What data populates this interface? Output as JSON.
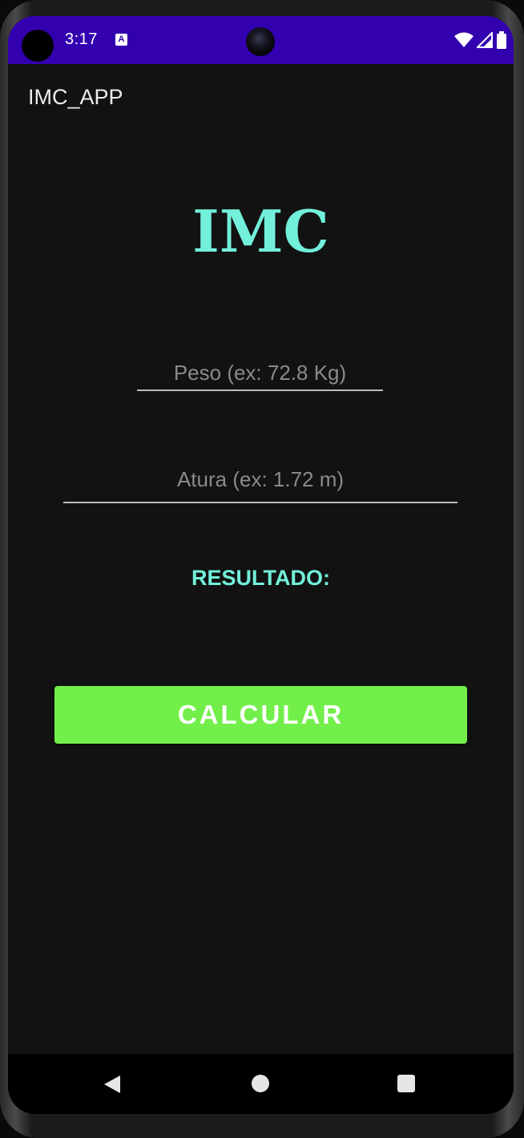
{
  "status_bar": {
    "time": "3:17",
    "notification_icon": "a-icon",
    "icons": [
      "wifi-icon",
      "signal-icon",
      "battery-icon"
    ]
  },
  "app_bar": {
    "title": "IMC_APP"
  },
  "main": {
    "heading": "IMC",
    "peso_input": {
      "value": "",
      "placeholder": "Peso (ex: 72.8 Kg)"
    },
    "altura_input": {
      "value": "",
      "placeholder": "Atura (ex: 1.72 m)"
    },
    "result_label": "RESULTADO:",
    "calculate_button": "CALCULAR"
  },
  "nav_bar": {
    "icons": [
      "back-icon",
      "home-icon",
      "recents-icon"
    ]
  },
  "colors": {
    "status_bar": "#3300b0",
    "background": "#121212",
    "accent_teal": "#72f0da",
    "button_green": "#72ef4a",
    "nav_bar": "#000000"
  }
}
